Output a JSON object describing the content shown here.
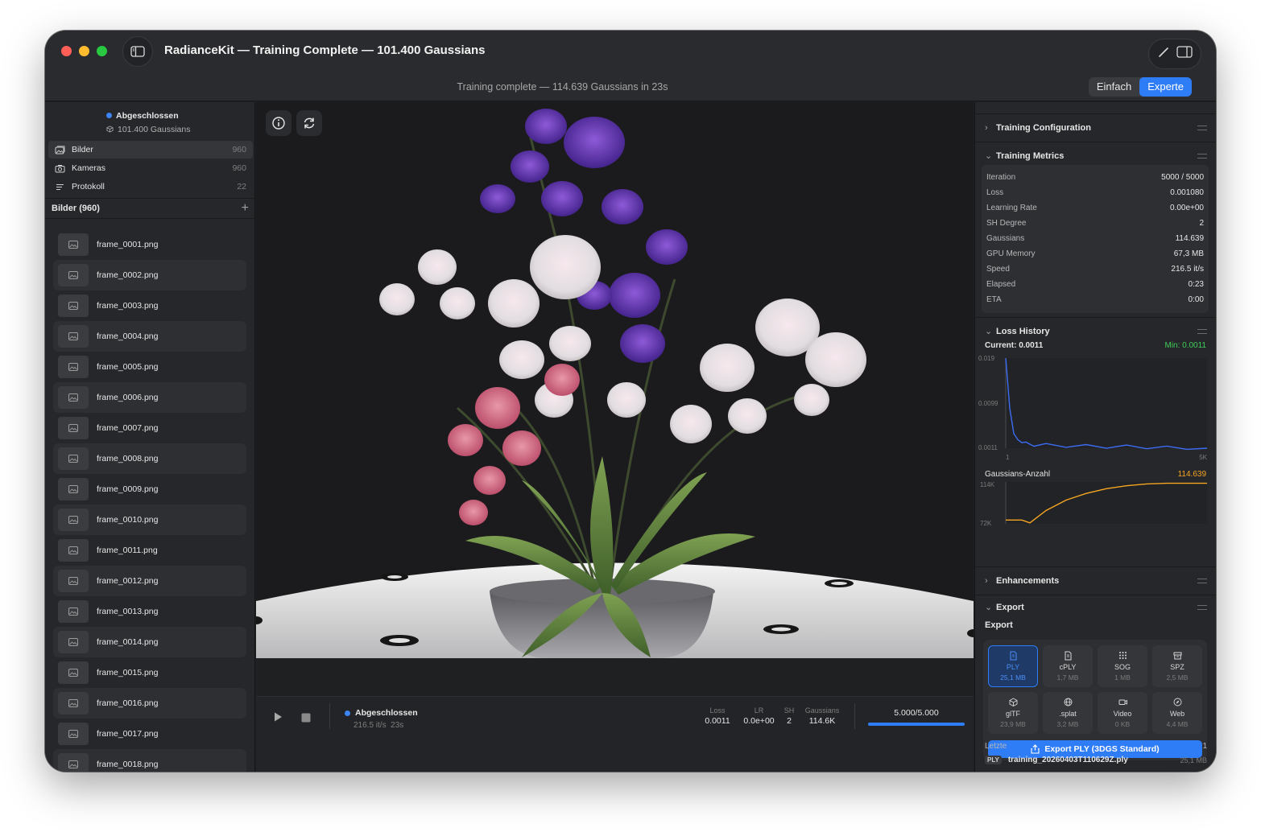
{
  "window": {
    "title": "RadianceKit — Training Complete — 101.400 Gaussians",
    "subtitle": "Training complete — 114.639 Gaussians in 23s",
    "mode_simple": "Einfach",
    "mode_expert": "Experte"
  },
  "sidebar": {
    "status": "Abgeschlossen",
    "gaussians": "101.400 Gaussians",
    "nav": [
      {
        "label": "Bilder",
        "count": "960"
      },
      {
        "label": "Kameras",
        "count": "960"
      },
      {
        "label": "Protokoll",
        "count": "22"
      }
    ],
    "section_title": "Bilder (960)",
    "files": [
      "frame_0001.png",
      "frame_0002.png",
      "frame_0003.png",
      "frame_0004.png",
      "frame_0005.png",
      "frame_0006.png",
      "frame_0007.png",
      "frame_0008.png",
      "frame_0009.png",
      "frame_0010.png",
      "frame_0011.png",
      "frame_0012.png",
      "frame_0013.png",
      "frame_0014.png",
      "frame_0015.png",
      "frame_0016.png",
      "frame_0017.png",
      "frame_0018.png"
    ]
  },
  "transport": {
    "status": "Abgeschlossen",
    "speed": "216.5 it/s",
    "time": "23s",
    "metrics": [
      {
        "label": "Loss",
        "value": "0.0011"
      },
      {
        "label": "LR",
        "value": "0.0e+00"
      },
      {
        "label": "SH",
        "value": "2"
      },
      {
        "label": "Gaussians",
        "value": "114.6K"
      }
    ],
    "progress_text": "5.000/5.000",
    "progress": 1.0
  },
  "inspector": {
    "training_configuration": "Training Configuration",
    "training_metrics": "Training Metrics",
    "metrics": [
      {
        "key": "Iteration",
        "value": "5000 / 5000"
      },
      {
        "key": "Loss",
        "value": "0.001080"
      },
      {
        "key": "Learning Rate",
        "value": "0.00e+00"
      },
      {
        "key": "SH Degree",
        "value": "2"
      },
      {
        "key": "Gaussians",
        "value": "114.639"
      },
      {
        "key": "GPU Memory",
        "value": "67,3 MB"
      },
      {
        "key": "Speed",
        "value": "216.5 it/s"
      },
      {
        "key": "Elapsed",
        "value": "0:23"
      },
      {
        "key": "ETA",
        "value": "0:00"
      }
    ],
    "loss_history": "Loss History",
    "loss_current": "Current: 0.0011",
    "loss_min": "Min: 0.0011",
    "loss_ticks": {
      "y_top": "0.019",
      "y_mid": "0.0099",
      "y_bottom": "0.0011",
      "x_start": "1",
      "x_end": "5K"
    },
    "gauss_title": "Gaussians-Anzahl",
    "gauss_value": "114.639",
    "gauss_ticks": {
      "y_top": "114K",
      "y_bottom": "72K"
    },
    "enhancements": "Enhancements",
    "export_head": "Export",
    "export_label": "Export",
    "formats": [
      {
        "name": "PLY",
        "size": "25,1 MB",
        "icon": "document-icon"
      },
      {
        "name": "cPLY",
        "size": "1,7 MB",
        "icon": "document-icon"
      },
      {
        "name": "SOG",
        "size": "1 MB",
        "icon": "grid-icon"
      },
      {
        "name": "SPZ",
        "size": "2,5 MB",
        "icon": "archive-icon"
      },
      {
        "name": "glTF",
        "size": "23,9 MB",
        "icon": "cube-icon"
      },
      {
        "name": ".splat",
        "size": "3,2 MB",
        "icon": "globe-icon"
      },
      {
        "name": "Video",
        "size": "0 KB",
        "icon": "video-icon"
      },
      {
        "name": "Web",
        "size": "4,4 MB",
        "icon": "compass-icon"
      }
    ],
    "export_button": "Export PLY (3DGS Standard)",
    "recent_label": "Letzte",
    "recent_count": "1",
    "recent_badge": "PLY",
    "recent_file": "training_20260403T110629Z.ply",
    "recent_size": "25,1 MB"
  },
  "chart_data": [
    {
      "type": "line",
      "title": "Loss History",
      "x": [
        1,
        100,
        200,
        300,
        400,
        500,
        700,
        1000,
        1500,
        2000,
        2500,
        3000,
        3500,
        4000,
        4500,
        5000
      ],
      "series": [
        {
          "values": [
            0.019,
            0.009,
            0.004,
            0.0028,
            0.0022,
            0.002,
            0.0018,
            0.0017,
            0.0016,
            0.0015,
            0.0014,
            0.0014,
            0.0013,
            0.0012,
            0.0012,
            0.0011
          ]
        }
      ],
      "ylim": [
        0.0011,
        0.019
      ],
      "xlim": [
        1,
        5000
      ]
    },
    {
      "type": "line",
      "title": "Gaussians-Anzahl",
      "x": [
        0,
        400,
        600,
        1000,
        1500,
        2000,
        2500,
        3000,
        3500,
        4000,
        5000
      ],
      "series": [
        {
          "values": [
            76000,
            76000,
            73000,
            86000,
            97000,
            104000,
            109000,
            112000,
            114000,
            114639,
            114639
          ]
        }
      ],
      "ylim": [
        72000,
        116000
      ]
    }
  ],
  "colors": {
    "accent": "#2e7cf6",
    "loss_line": "#3d6cf5",
    "gauss_line": "#f5a623",
    "min_label": "#3fcf5a"
  }
}
